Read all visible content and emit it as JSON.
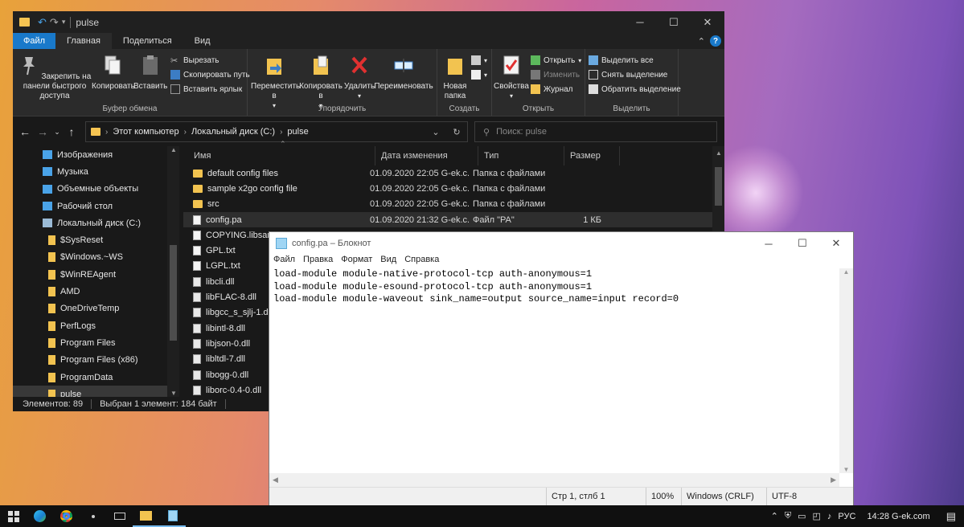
{
  "explorer": {
    "title": "pulse",
    "ribbon_tabs": [
      "Файл",
      "Главная",
      "Поделиться",
      "Вид"
    ],
    "groups": {
      "clipboard": {
        "label": "Буфер обмена",
        "pin": "Закрепить на панели быстрого доступа",
        "copy": "Копировать",
        "paste": "Вставить",
        "cut": "Вырезать",
        "copy_path": "Скопировать путь",
        "paste_shortcut": "Вставить ярлык"
      },
      "organize": {
        "label": "Упорядочить",
        "move_to": "Переместить в",
        "copy_to": "Копировать в",
        "delete": "Удалить",
        "rename": "Переименовать"
      },
      "new": {
        "label": "Создать",
        "new_folder": "Новая папка"
      },
      "open": {
        "label": "Открыть",
        "properties": "Свойства",
        "open": "Открыть",
        "edit": "Изменить",
        "history": "Журнал"
      },
      "select": {
        "label": "Выделить",
        "select_all": "Выделить все",
        "select_none": "Снять выделение",
        "invert": "Обратить выделение"
      }
    },
    "address": {
      "crumbs": [
        "Этот компьютер",
        "Локальный диск (C:)",
        "pulse"
      ]
    },
    "search": {
      "placeholder": "Поиск: pulse"
    },
    "nav_items": [
      {
        "label": "Изображения",
        "indent": 1
      },
      {
        "label": "Музыка",
        "indent": 1
      },
      {
        "label": "Объемные объекты",
        "indent": 1
      },
      {
        "label": "Рабочий стол",
        "indent": 1
      },
      {
        "label": "Локальный диск (C:)",
        "indent": 1
      },
      {
        "label": "$SysReset",
        "indent": 2
      },
      {
        "label": "$Windows.~WS",
        "indent": 2
      },
      {
        "label": "$WinREAgent",
        "indent": 2
      },
      {
        "label": "AMD",
        "indent": 2
      },
      {
        "label": "OneDriveTemp",
        "indent": 2
      },
      {
        "label": "PerfLogs",
        "indent": 2
      },
      {
        "label": "Program Files",
        "indent": 2
      },
      {
        "label": "Program Files (x86)",
        "indent": 2
      },
      {
        "label": "ProgramData",
        "indent": 2
      },
      {
        "label": "pulse",
        "indent": 2
      }
    ],
    "columns": [
      "Имя",
      "Дата изменения",
      "Тип",
      "Размер"
    ],
    "files": [
      {
        "name": "default config files",
        "date": "01.09.2020 22:05",
        "author": "G-ek.c...",
        "type": "Папка с файлами",
        "size": "",
        "kind": "folder"
      },
      {
        "name": "sample x2go config file",
        "date": "01.09.2020 22:05",
        "author": "G-ek.c...",
        "type": "Папка с файлами",
        "size": "",
        "kind": "folder"
      },
      {
        "name": "src",
        "date": "01.09.2020 22:05",
        "author": "G-ek.c...",
        "type": "Папка с файлами",
        "size": "",
        "kind": "folder"
      },
      {
        "name": "config.pa",
        "date": "01.09.2020 21:32",
        "author": "G-ek.c...",
        "type": "Файл \"PA\"",
        "size": "1 КБ",
        "kind": "file"
      },
      {
        "name": "COPYING.libsam",
        "date": "",
        "author": "",
        "type": "",
        "size": "",
        "kind": "file"
      },
      {
        "name": "GPL.txt",
        "date": "",
        "author": "",
        "type": "",
        "size": "",
        "kind": "file"
      },
      {
        "name": "LGPL.txt",
        "date": "",
        "author": "",
        "type": "",
        "size": "",
        "kind": "file"
      },
      {
        "name": "libcli.dll",
        "date": "",
        "author": "",
        "type": "",
        "size": "",
        "kind": "dll"
      },
      {
        "name": "libFLAC-8.dll",
        "date": "",
        "author": "",
        "type": "",
        "size": "",
        "kind": "dll"
      },
      {
        "name": "libgcc_s_sjlj-1.dl",
        "date": "",
        "author": "",
        "type": "",
        "size": "",
        "kind": "dll"
      },
      {
        "name": "libintl-8.dll",
        "date": "",
        "author": "",
        "type": "",
        "size": "",
        "kind": "dll"
      },
      {
        "name": "libjson-0.dll",
        "date": "",
        "author": "",
        "type": "",
        "size": "",
        "kind": "dll"
      },
      {
        "name": "libltdl-7.dll",
        "date": "",
        "author": "",
        "type": "",
        "size": "",
        "kind": "dll"
      },
      {
        "name": "libogg-0.dll",
        "date": "",
        "author": "",
        "type": "",
        "size": "",
        "kind": "dll"
      },
      {
        "name": "liborc-0.4-0.dll",
        "date": "",
        "author": "",
        "type": "",
        "size": "",
        "kind": "dll"
      }
    ],
    "status": {
      "count": "Элементов: 89",
      "selected": "Выбран 1 элемент: 184 байт"
    }
  },
  "notepad": {
    "title": "config.pa – Блокнот",
    "menu": [
      "Файл",
      "Правка",
      "Формат",
      "Вид",
      "Справка"
    ],
    "content": "load-module module-native-protocol-tcp auth-anonymous=1\nload-module module-esound-protocol-tcp auth-anonymous=1\nload-module module-waveout sink_name=output source_name=input record=0",
    "status": {
      "position": "Стр 1, стлб 1",
      "zoom": "100%",
      "eol": "Windows (CRLF)",
      "encoding": "UTF-8"
    }
  },
  "taskbar": {
    "lang": "РУС",
    "clock": "14:28 G-ek.com"
  },
  "colors": {
    "accent": "#1979ca",
    "folder": "#f2c350",
    "explorer_bg": "#191919",
    "ribbon_bg": "#2b2b2b"
  }
}
